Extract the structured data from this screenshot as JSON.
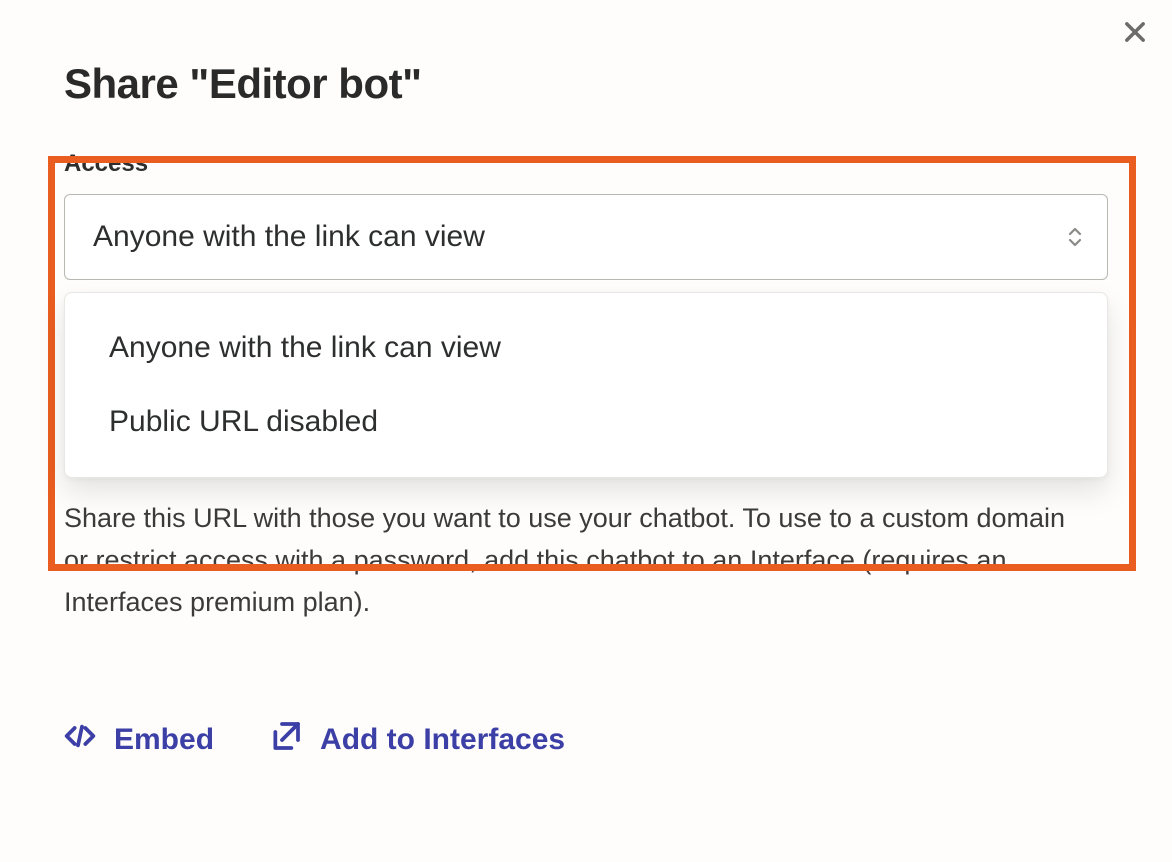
{
  "title": "Share \"Editor bot\"",
  "access": {
    "label": "Access",
    "selected": "Anyone with the link can view",
    "options": [
      "Anyone with the link can view",
      "Public URL disabled"
    ]
  },
  "help_text": "Share this URL with those you want to use your chatbot. To use to a custom domain or restrict access with a password, add this chatbot to an Interface (requires an Interfaces premium plan).",
  "actions": {
    "embed": "Embed",
    "add_to_interfaces": "Add to Interfaces"
  },
  "colors": {
    "highlight": "#ea5d20",
    "link": "#3b3fa6"
  }
}
